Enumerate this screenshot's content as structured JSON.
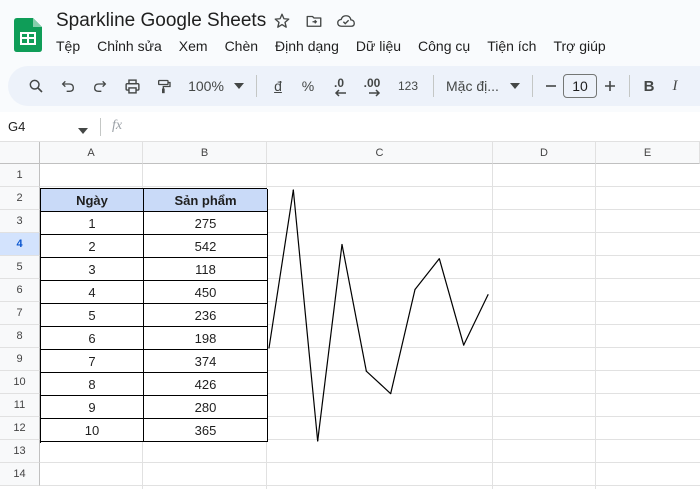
{
  "title": "Sparkline Google Sheets",
  "menu": [
    "Tệp",
    "Chỉnh sửa",
    "Xem",
    "Chèn",
    "Định dạng",
    "Dữ liệu",
    "Công cụ",
    "Tiện ích",
    "Trợ giúp"
  ],
  "toolbar": {
    "zoom": "100%",
    "currency": "đ",
    "percent": "%",
    "dec_decrease": ".0",
    "dec_increase": ".00",
    "number_format": "123",
    "font": "Mặc đị...",
    "font_size": "10",
    "bold": "B",
    "italic": "I"
  },
  "formula_bar": {
    "cell_ref": "G4",
    "fx": "fx"
  },
  "columns": [
    "A",
    "B",
    "C",
    "D",
    "E"
  ],
  "rows": [
    "1",
    "2",
    "3",
    "4",
    "5",
    "6",
    "7",
    "8",
    "9",
    "10",
    "11",
    "12",
    "13",
    "14"
  ],
  "active_row": "4",
  "table": {
    "headers": [
      "Ngày",
      "Sản phẩm"
    ],
    "rows": [
      [
        "1",
        "275"
      ],
      [
        "2",
        "542"
      ],
      [
        "3",
        "118"
      ],
      [
        "4",
        "450"
      ],
      [
        "5",
        "236"
      ],
      [
        "6",
        "198"
      ],
      [
        "7",
        "374"
      ],
      [
        "8",
        "426"
      ],
      [
        "9",
        "280"
      ],
      [
        "10",
        "365"
      ]
    ]
  },
  "chart_data": {
    "type": "line",
    "x": [
      1,
      2,
      3,
      4,
      5,
      6,
      7,
      8,
      9,
      10
    ],
    "values": [
      275,
      542,
      118,
      450,
      236,
      198,
      374,
      426,
      280,
      365
    ]
  },
  "colors": {
    "header_fill": "#c9daf8",
    "sheets_green": "#0f9d58",
    "toolbar_bg": "#edf2fa"
  }
}
